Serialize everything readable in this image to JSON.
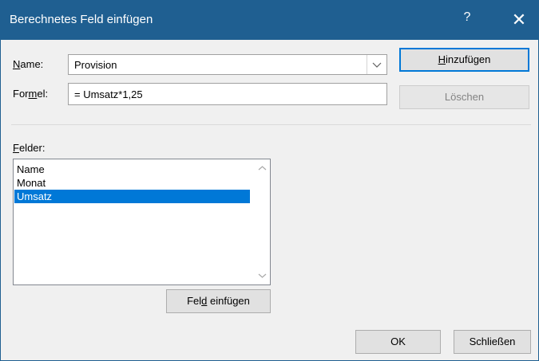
{
  "window": {
    "title": "Berechnetes Feld einfügen",
    "help_glyph": "?",
    "close_glyph": "✕"
  },
  "name_field": {
    "label_prefix": "",
    "label_accel": "N",
    "label_suffix": "ame:",
    "value": "Provision",
    "dropdown_icon": "chevron-down-icon"
  },
  "formula_field": {
    "label_prefix": "For",
    "label_accel": "m",
    "label_suffix": "el:",
    "value": "= Umsatz*1,25"
  },
  "buttons": {
    "add": {
      "prefix": "",
      "accel": "H",
      "suffix": "inzufügen"
    },
    "delete": {
      "label": "Löschen"
    },
    "insert_field": {
      "prefix": "Fel",
      "accel": "d",
      "suffix": " einfügen"
    },
    "ok": {
      "label": "OK"
    },
    "close": {
      "label": "Schließen"
    }
  },
  "fields": {
    "label_accel": "F",
    "label_suffix": "elder:",
    "items": [
      "Name",
      "Monat",
      "Umsatz"
    ],
    "selected": "Umsatz"
  },
  "colors": {
    "titlebar": "#1f5f91",
    "selection": "#0078d7",
    "dialog_bg": "#f0f0f0"
  }
}
